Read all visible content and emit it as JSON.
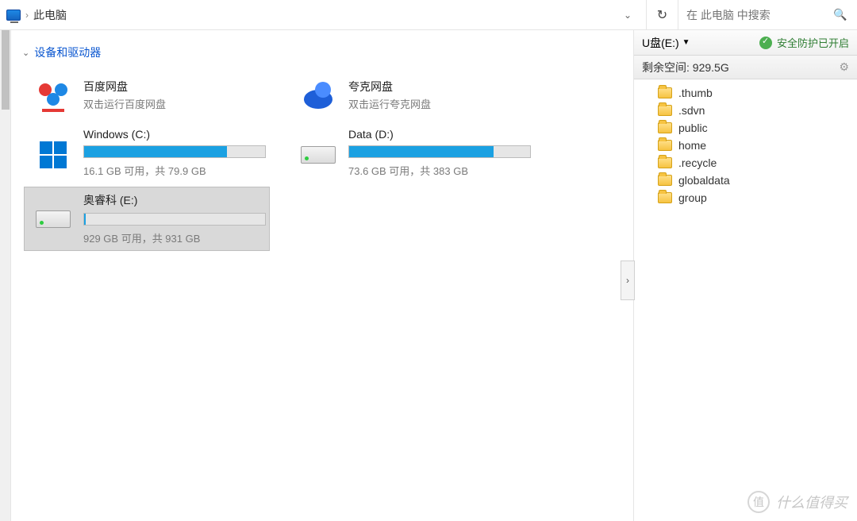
{
  "addressbar": {
    "location": "此电脑",
    "search_placeholder": "在 此电脑 中搜索"
  },
  "section": {
    "title": "设备和驱动器"
  },
  "items": {
    "baidu": {
      "title": "百度网盘",
      "sub": "双击运行百度网盘"
    },
    "quark": {
      "title": "夸克网盘",
      "sub": "双击运行夸克网盘"
    }
  },
  "drives": {
    "c": {
      "title": "Windows (C:)",
      "sub": "16.1 GB 可用，共 79.9 GB",
      "fill_pct": 79
    },
    "d": {
      "title": "Data (D:)",
      "sub": "73.6 GB 可用，共 383 GB",
      "fill_pct": 80
    },
    "e": {
      "title": "奥睿科 (E:)",
      "sub": "929 GB 可用，共 931 GB",
      "fill_pct": 1
    }
  },
  "sidebar": {
    "drive_label": "U盘(E:)",
    "protection": "安全防护已开启",
    "space_label": "剩余空间: 929.5G",
    "folders": [
      {
        "name": ".thumb"
      },
      {
        "name": ".sdvn"
      },
      {
        "name": "public"
      },
      {
        "name": "home"
      },
      {
        "name": ".recycle"
      },
      {
        "name": "globaldata"
      },
      {
        "name": "group"
      }
    ]
  },
  "watermark": {
    "text": "什么值得买",
    "badge": "值"
  }
}
